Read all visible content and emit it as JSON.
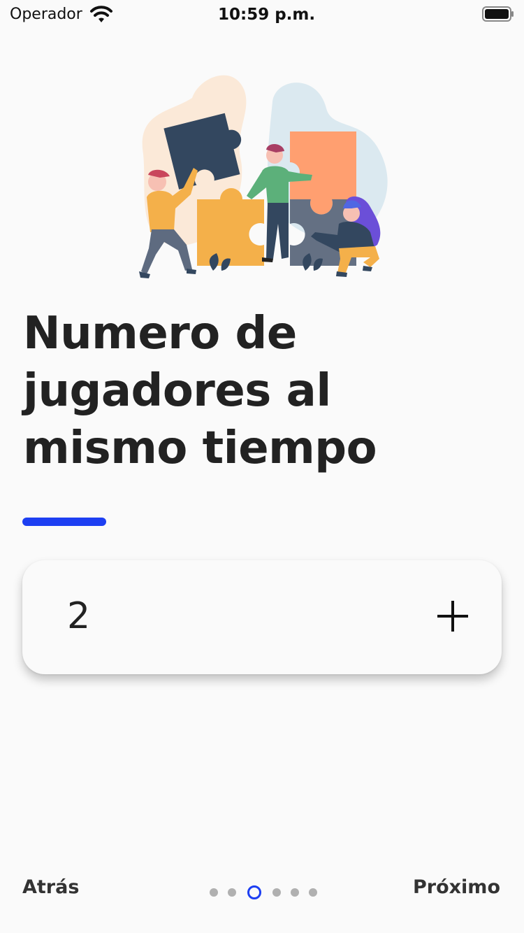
{
  "status_bar": {
    "carrier": "Operador",
    "time": "10:59 p.m."
  },
  "content": {
    "title": "Numero de jugadores al mismo tiempo",
    "counter_value": "2"
  },
  "footer": {
    "back_label": "Atrás",
    "next_label": "Próximo",
    "page_count": 6,
    "current_page": 3
  },
  "colors": {
    "accent": "#1d3ff2",
    "background": "#fafafa",
    "text": "#222222"
  }
}
